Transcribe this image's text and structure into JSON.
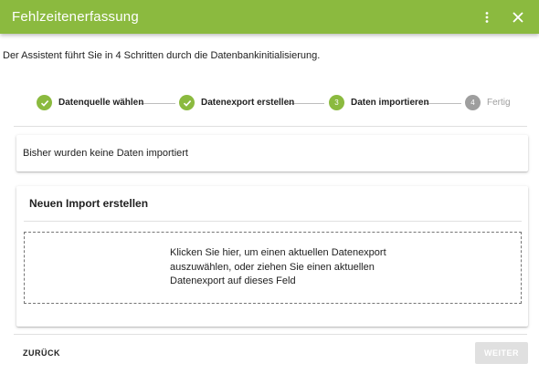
{
  "window": {
    "title": "Fehlzeitenerfassung",
    "accent_color": "#8bba3f",
    "menu_icon": "more-vert-icon",
    "close_icon": "close-icon"
  },
  "intro_text": "Der Assistent führt Sie in 4 Schritten durch die Datenbankinitialisierung.",
  "stepper": {
    "steps": [
      {
        "label": "Datenquelle wählen",
        "state": "completed",
        "icon": "check-icon"
      },
      {
        "label": "Datenexport erstellen",
        "state": "completed",
        "icon": "check-icon"
      },
      {
        "label": "Daten importieren",
        "state": "active",
        "number": "3"
      },
      {
        "label": "Fertig",
        "state": "inactive",
        "number": "4"
      }
    ]
  },
  "status": {
    "text": "Bisher wurden keine Daten importiert"
  },
  "import": {
    "title": "Neuen Import erstellen",
    "dropzone_lines": [
      "Klicken Sie hier, um einen aktuellen Datenexport",
      "auszuwählen, oder ziehen Sie einen aktuellen",
      "Datenexport auf dieses Feld"
    ]
  },
  "footer": {
    "back_label": "ZURÜCK",
    "next_label": "WEITER",
    "next_disabled": true
  }
}
